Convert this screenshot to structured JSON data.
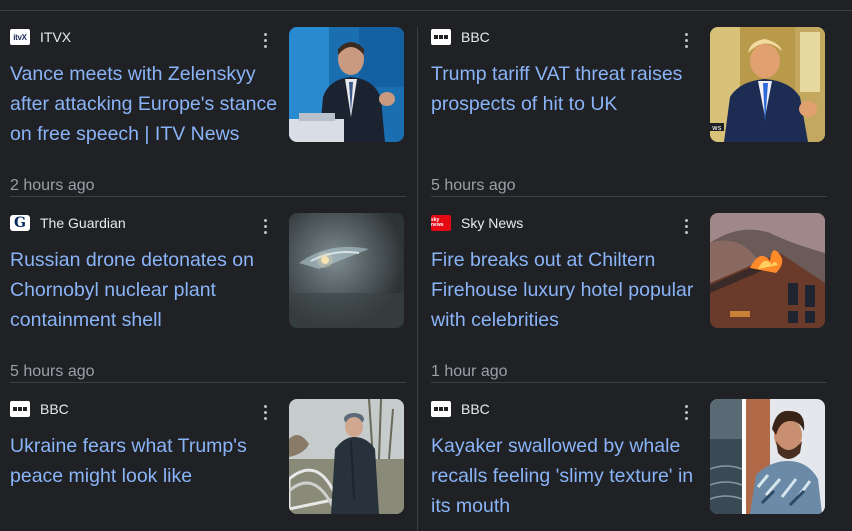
{
  "articles": [
    {
      "source": "ITVX",
      "source_icon": "itvx-logo-icon",
      "headline": "Vance meets with Zelenskyy after attacking Europe's stance on free speech | ITV News",
      "time": "2 hours ago",
      "thumbnail": "man-speaking-at-podium-image"
    },
    {
      "source": "BBC",
      "source_icon": "bbc-logo-icon",
      "headline": "Trump tariff VAT threat raises prospects of hit to UK",
      "time": "5 hours ago",
      "thumbnail": "man-in-oval-office-image"
    },
    {
      "source": "The Guardian",
      "source_icon": "guardian-logo-icon",
      "headline": "Russian drone detonates on Chornobyl nuclear plant containment shell",
      "time": "5 hours ago",
      "thumbnail": "drone-impact-night-image"
    },
    {
      "source": "Sky News",
      "source_icon": "sky-news-logo-icon",
      "headline": "Fire breaks out at Chiltern Firehouse luxury hotel popular with celebrities",
      "time": "1 hour ago",
      "thumbnail": "building-on-fire-image"
    },
    {
      "source": "BBC",
      "source_icon": "bbc-logo-icon",
      "headline": "Ukraine fears what Trump's peace might look like",
      "time": "",
      "thumbnail": "man-in-winter-coat-image"
    },
    {
      "source": "BBC",
      "source_icon": "bbc-logo-icon",
      "headline": "Kayaker swallowed by whale recalls feeling 'slimy texture' in its mouth",
      "time": "",
      "thumbnail": "kayaker-portrait-image"
    }
  ],
  "logo_text": {
    "itvx": "itvX",
    "guardian": "G",
    "sky": "sky news"
  },
  "colors": {
    "background": "#202124",
    "headline": "#8ab4f8",
    "source_text": "#e8eaed",
    "time_text": "#9aa0a6",
    "divider": "#3c4043",
    "sky_red": "#e50914"
  }
}
